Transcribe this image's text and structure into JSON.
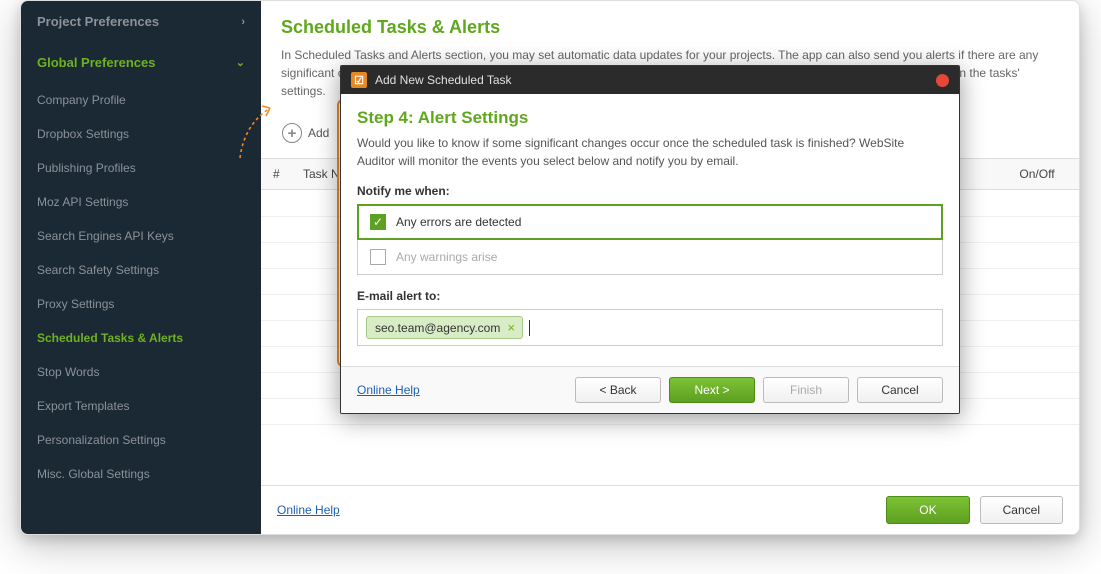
{
  "sidebar": {
    "project": "Project Preferences",
    "global": "Global Preferences",
    "items": [
      "Company Profile",
      "Dropbox Settings",
      "Publishing Profiles",
      "Moz API Settings",
      "Search Engines API Keys",
      "Search Safety Settings",
      "Proxy Settings",
      "Scheduled Tasks & Alerts",
      "Stop Words",
      "Export Templates",
      "Personalization Settings",
      "Misc. Global Settings"
    ],
    "active_index": 7
  },
  "main": {
    "title": "Scheduled Tasks & Alerts",
    "desc": "In Scheduled Tasks and Alerts section, you may set automatic data updates for your projects. The app can also send you alerts if there are any significant changes spotted. Double-click on tasks to edit them, or create new ones. Alerts can be enabled or disabled any time in the tasks' settings.",
    "add_label": "Add",
    "columns": {
      "num": "#",
      "task": "Task Name",
      "onoff": "On/Off"
    },
    "online_help": "Online Help",
    "ok": "OK",
    "cancel": "Cancel"
  },
  "modal": {
    "title": "Add New Scheduled Task",
    "step_title": "Step 4: Alert Settings",
    "step_desc": "Would you like to know if some significant changes occur once the scheduled task is finished? WebSite Auditor will monitor the events you select below and notify you by email.",
    "notify_label": "Notify me when:",
    "alert_errors": "Any errors are detected",
    "alert_warnings": "Any warnings arise",
    "email_label": "E-mail alert to:",
    "email_chip": "seo.team@agency.com",
    "online_help": "Online Help",
    "back": "< Back",
    "next": "Next >",
    "finish": "Finish",
    "cancel": "Cancel"
  }
}
